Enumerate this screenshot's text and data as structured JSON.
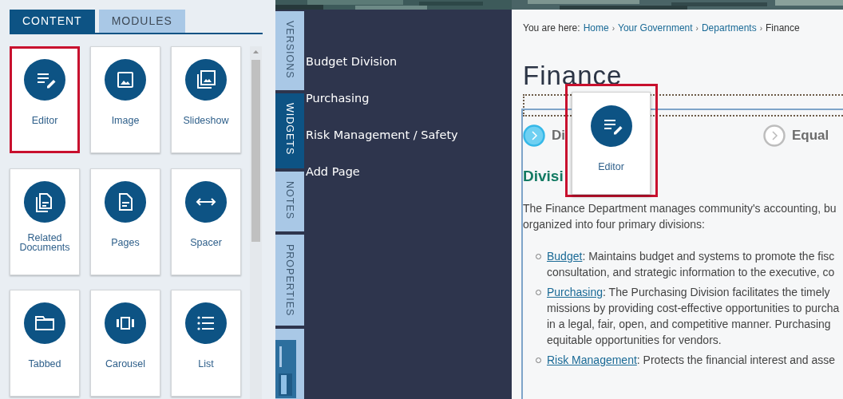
{
  "panel_tabs": [
    {
      "label": "CONTENT",
      "selected": true
    },
    {
      "label": "MODULES",
      "selected": false
    }
  ],
  "widgets": [
    {
      "label": "Editor",
      "highlighted": true
    },
    {
      "label": "Image",
      "highlighted": false
    },
    {
      "label": "Slideshow",
      "highlighted": false
    },
    {
      "label": "Related Documents",
      "highlighted": false
    },
    {
      "label": "Pages",
      "highlighted": false
    },
    {
      "label": "Spacer",
      "highlighted": false
    },
    {
      "label": "Tabbed",
      "highlighted": false
    },
    {
      "label": "Carousel",
      "highlighted": false
    },
    {
      "label": "List",
      "highlighted": false
    }
  ],
  "side_tabs": [
    {
      "label": "VERSIONS",
      "selected": false
    },
    {
      "label": "WIDGETS",
      "selected": true
    },
    {
      "label": "NOTES",
      "selected": false
    },
    {
      "label": "PROPERTIES",
      "selected": false
    }
  ],
  "pages": [
    "Budget Division",
    "Purchasing",
    "Risk Management / Safety",
    "Add Page"
  ],
  "breadcrumb": {
    "prefix": "You are here:",
    "separator": "›",
    "links": [
      "Home",
      "Your Government",
      "Departments"
    ],
    "current": "Finance"
  },
  "title": "Finance",
  "content_tabs": [
    {
      "label": "Di",
      "selected": true
    },
    {
      "label": "Equal",
      "selected": false
    }
  ],
  "heading": "Divisi",
  "intro_lines": [
    "The Finance Department manages community's accounting, bu",
    "organized into four primary divisions:"
  ],
  "list": [
    {
      "link": "Budget",
      "lines": [
        ": Maintains budget and systems to promote the fisc",
        "consultation, and strategic information to the executive, co"
      ]
    },
    {
      "link": "Purchasing",
      "lines": [
        ": The Purchasing Division facilitates the timely",
        "missions by providing cost-effective opportunities to purcha",
        "in a legal, fair, open, and competitive manner. Purchasing",
        "equitable opportunities for vendors."
      ]
    },
    {
      "link": "Risk Management",
      "lines": [
        ": Protects the financial interest and asse"
      ]
    }
  ],
  "drag_card": {
    "label": "Editor"
  }
}
